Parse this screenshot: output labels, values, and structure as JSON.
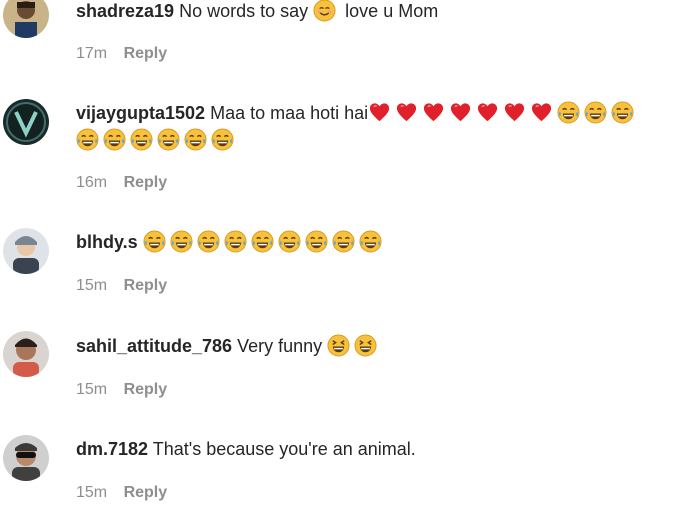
{
  "comments": [
    {
      "username": "shadreza19",
      "text": "No words to say",
      "text_after": "love u Mom",
      "emojis_mid": [
        "smiling-face-icon"
      ],
      "time": "17m",
      "reply_label": "Reply"
    },
    {
      "username": "vijaygupta1502",
      "text": "Maa to maa hoti hai",
      "emojis_line1": [
        "red-heart-icon",
        "red-heart-icon",
        "red-heart-icon",
        "red-heart-icon",
        "red-heart-icon",
        "red-heart-icon",
        "red-heart-icon",
        "tears-of-joy-icon",
        "tears-of-joy-icon",
        "tears-of-joy-icon"
      ],
      "emojis_line2": [
        "tears-of-joy-icon",
        "tears-of-joy-icon",
        "tears-of-joy-icon",
        "tears-of-joy-icon",
        "tears-of-joy-icon",
        "tears-of-joy-icon"
      ],
      "time": "16m",
      "reply_label": "Reply"
    },
    {
      "username": "blhdy.s",
      "text": "",
      "emojis": [
        "tears-of-joy-icon",
        "tears-of-joy-icon",
        "tears-of-joy-icon",
        "tears-of-joy-icon",
        "tears-of-joy-icon",
        "tears-of-joy-icon",
        "tears-of-joy-icon",
        "tears-of-joy-icon",
        "tears-of-joy-icon"
      ],
      "time": "15m",
      "reply_label": "Reply"
    },
    {
      "username": "sahil_attitude_786",
      "text": "Very funny",
      "emojis": [
        "grinning-squinting-face-icon",
        "grinning-squinting-face-icon"
      ],
      "time": "15m",
      "reply_label": "Reply"
    },
    {
      "username": "dm.7182",
      "text": "That's because you're an animal.",
      "time": "15m",
      "reply_label": "Reply"
    }
  ],
  "colors": {
    "text": "#262626",
    "meta": "#8e8e8e",
    "emoji_yellow": "#f7c13c",
    "heart_red": "#e0202a",
    "tear_blue": "#4aa8e8"
  }
}
